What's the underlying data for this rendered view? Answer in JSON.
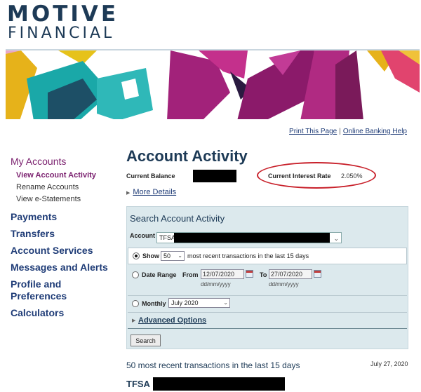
{
  "brand": {
    "line1": "MOTIVE",
    "line2": "FINANCIAL"
  },
  "utility": {
    "print": "Print This Page",
    "separator": "|",
    "help": "Online Banking Help"
  },
  "nav": {
    "my_accounts": "My Accounts",
    "sub": [
      "View Account Activity",
      "Rename Accounts",
      "View e-Statements"
    ],
    "sections": [
      "Payments",
      "Transfers",
      "Account Services",
      "Messages and Alerts",
      "Profile and Preferences",
      "Calculators"
    ]
  },
  "main": {
    "title": "Account Activity",
    "balance_label": "Current Balance",
    "rate_label": "Current Interest Rate",
    "rate_value": "2.050%",
    "more_details": "More Details"
  },
  "search": {
    "heading": "Search Account Activity",
    "account_label": "Account",
    "account_value": "TFSA",
    "show_label": "Show",
    "show_count": "50",
    "show_suffix": "most recent transactions in the last 15 days",
    "range_label": "Date Range",
    "from_label": "From",
    "from_value": "12/07/2020",
    "to_label": "To",
    "to_value": "27/07/2020",
    "date_format": "dd/mm/yyyy",
    "monthly_label": "Monthly",
    "month_value": "July 2020",
    "advanced": "Advanced Options",
    "button": "Search"
  },
  "results": {
    "title": "50 most recent transactions in the last 15 days",
    "date": "July 27, 2020",
    "account_name": "TFSA"
  },
  "colors": {
    "navy": "#1d3a56",
    "purple": "#7a1f6e",
    "highlight_ring": "#c8202a",
    "panel": "#dce9ed"
  }
}
